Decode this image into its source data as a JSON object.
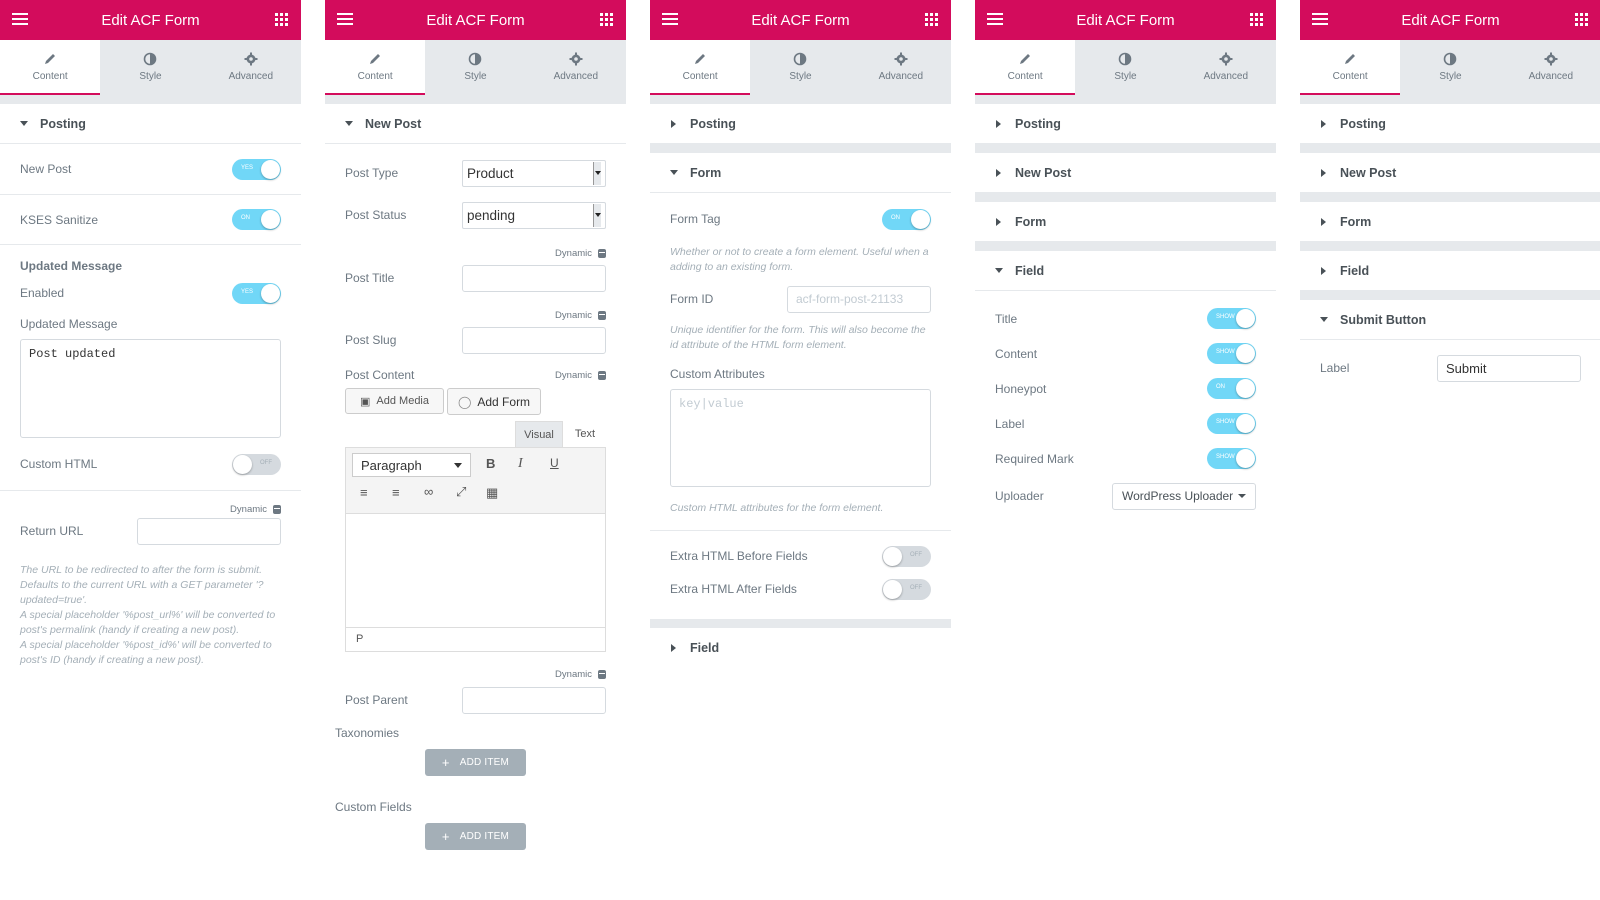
{
  "app": {
    "title": "Edit ACF Form"
  },
  "tabs": {
    "content": "Content",
    "style": "Style",
    "advanced": "Advanced"
  },
  "colors": {
    "brand": "#d30c5c",
    "switch_on": "#71d7f7",
    "switch_off": "#d5dadf"
  },
  "icons": {
    "menu": "hamburger-icon",
    "apps": "apps-grid-icon",
    "content": "pencil-icon",
    "style": "half-circle-icon",
    "advanced": "gear-icon",
    "dynamic": "database-icon"
  },
  "p1": {
    "section": "Posting",
    "new_post": {
      "label": "New Post",
      "toggle": "YES"
    },
    "kses": {
      "label": "KSES Sanitize",
      "toggle": "ON"
    },
    "updated_heading": "Updated Message",
    "enabled": {
      "label": "Enabled",
      "toggle": "YES"
    },
    "updated_label": "Updated Message",
    "updated_value": "Post updated",
    "custom_html": {
      "label": "Custom HTML",
      "toggle": "OFF"
    },
    "dynamic": "Dynamic",
    "return_url": "Return URL",
    "desc1": "The URL to be redirected to after the form is submit. Defaults to the current URL with a GET parameter '?updated=true'.",
    "desc2": "A special placeholder '%post_url%' will be converted to post's permalink (handy if creating a new post).",
    "desc3": "A special placeholder '%post_id%' will be converted to post's ID (handy if creating a new post)."
  },
  "p2": {
    "section": "New Post",
    "post_type": {
      "label": "Post Type",
      "value": "Product"
    },
    "post_status": {
      "label": "Post Status",
      "value": "pending"
    },
    "dynamic": "Dynamic",
    "post_title": "Post Title",
    "post_slug": "Post Slug",
    "post_content": "Post Content",
    "add_media": "Add Media",
    "add_form": "Add Form",
    "visual": "Visual",
    "text": "Text",
    "paragraph": "Paragraph",
    "status_p": "P",
    "post_parent": "Post Parent",
    "taxonomies": "Taxonomies",
    "add_item": "ADD ITEM",
    "custom_fields": "Custom Fields"
  },
  "p3": {
    "posting": "Posting",
    "form": "Form",
    "form_tag": {
      "label": "Form Tag",
      "toggle": "ON"
    },
    "form_tag_desc": "Whether or not to create a form element. Useful when a adding to an existing form.",
    "form_id": {
      "label": "Form ID",
      "placeholder": "acf-form-post-21133"
    },
    "form_id_desc": "Unique identifier for the form. This will also become the id attribute of the HTML form element.",
    "custom_attr": "Custom Attributes",
    "custom_attr_placeholder": "key|value",
    "custom_attr_desc": "Custom HTML attributes for the form element.",
    "extra_before": {
      "label": "Extra HTML Before Fields",
      "toggle": "OFF"
    },
    "extra_after": {
      "label": "Extra HTML After Fields",
      "toggle": "OFF"
    },
    "field": "Field"
  },
  "p4": {
    "posting": "Posting",
    "new_post": "New Post",
    "form": "Form",
    "field": "Field",
    "title": {
      "label": "Title",
      "toggle": "SHOW"
    },
    "content": {
      "label": "Content",
      "toggle": "SHOW"
    },
    "honeypot": {
      "label": "Honeypot",
      "toggle": "ON"
    },
    "label": {
      "label": "Label",
      "toggle": "SHOW"
    },
    "required": {
      "label": "Required Mark",
      "toggle": "SHOW"
    },
    "uploader": {
      "label": "Uploader",
      "value": "WordPress Uploader"
    }
  },
  "p5": {
    "posting": "Posting",
    "new_post": "New Post",
    "form": "Form",
    "field": "Field",
    "submit": "Submit Button",
    "label": "Label",
    "label_value": "Submit"
  }
}
